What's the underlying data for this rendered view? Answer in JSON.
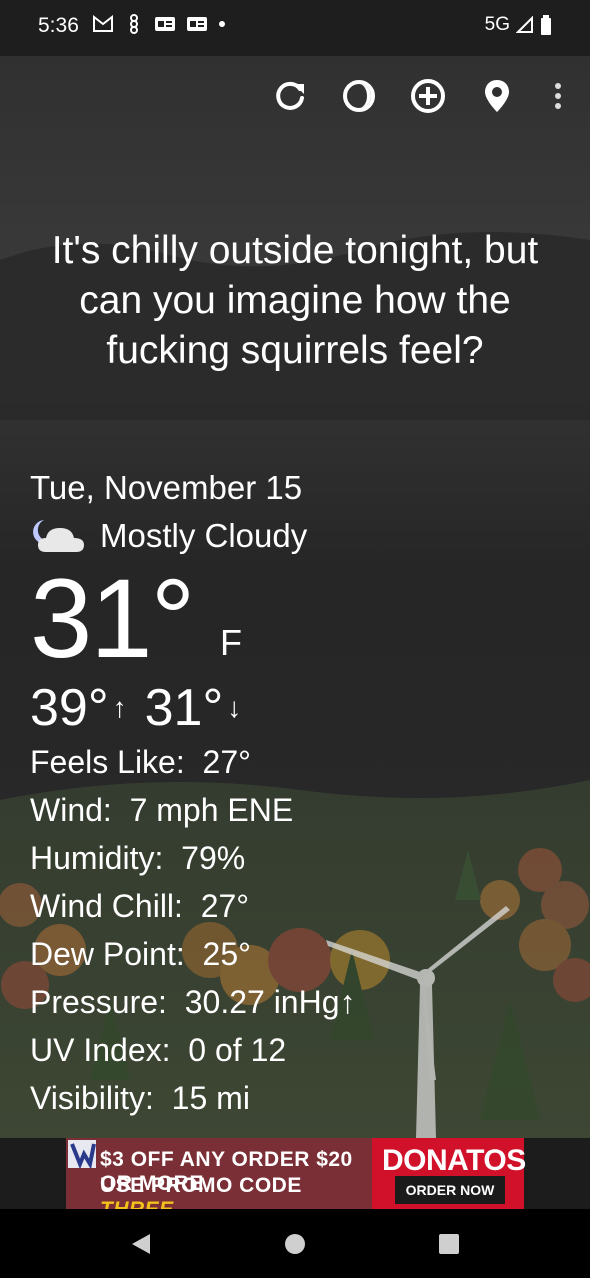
{
  "status_bar": {
    "time": "5:36",
    "network": "5G"
  },
  "headline": "It's chilly outside tonight, but can you imagine how the fucking squirrels feel?",
  "weather": {
    "date": "Tue, November 15",
    "condition": "Mostly Cloudy",
    "temperature": "31°",
    "unit": "F",
    "high": "39°",
    "low": "31°",
    "details": [
      {
        "label": "Feels Like:",
        "value": "27°"
      },
      {
        "label": "Wind:",
        "value": "7 mph ENE"
      },
      {
        "label": "Humidity:",
        "value": "79%"
      },
      {
        "label": "Wind Chill:",
        "value": "27°"
      },
      {
        "label": "Dew Point:",
        "value": "25°"
      },
      {
        "label": "Pressure:",
        "value": "30.27 inHg↑"
      },
      {
        "label": "UV Index:",
        "value": "0 of 12"
      },
      {
        "label": "Visibility:",
        "value": "15 mi"
      }
    ]
  },
  "ad": {
    "line1": "$3 OFF ANY ORDER $20 OR MORE",
    "line2_prefix": "USE PROMO CODE",
    "promo_code": "THREE",
    "brand": "DONATOS",
    "cta": "ORDER NOW"
  },
  "icons": {
    "toolbar": [
      "refresh-icon",
      "theme-icon",
      "add-location-icon",
      "location-pin-icon",
      "more-vert-icon"
    ],
    "nav": [
      "back-icon",
      "home-icon",
      "recents-icon"
    ]
  }
}
